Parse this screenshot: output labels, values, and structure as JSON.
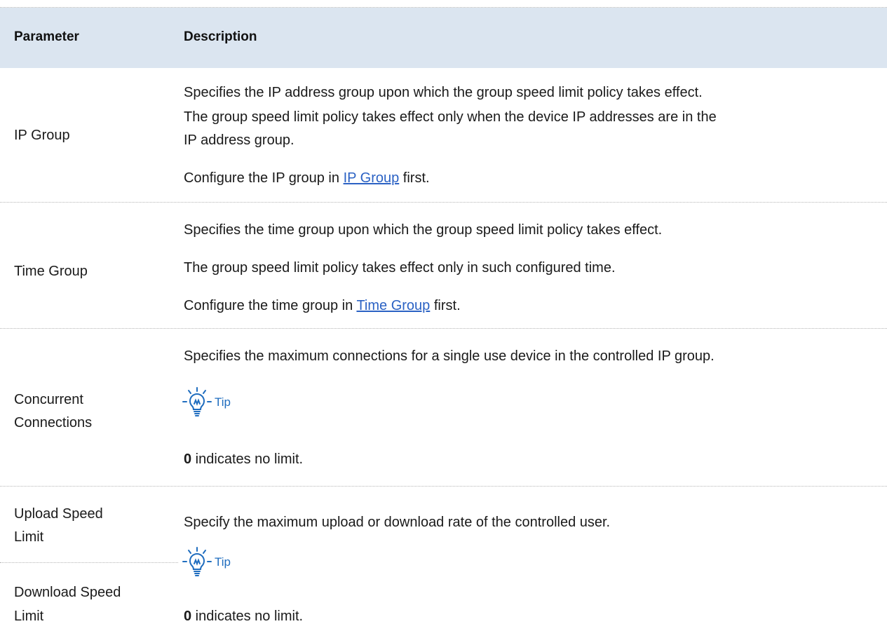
{
  "table": {
    "headers": [
      "Parameter",
      "Description"
    ],
    "rows": [
      {
        "param": "IP Group",
        "lines": [
          "Specifies the IP address group upon which the group speed limit policy takes effect.",
          "The group speed limit policy takes effect only when the device IP addresses are in the",
          "IP address group."
        ],
        "config_prefix": "Configure the IP group in ",
        "config_link": "IP Group",
        "config_suffix": " first."
      },
      {
        "param": "Time Group",
        "line1": "Specifies the time group upon which the group speed limit policy takes effect.",
        "line2": "The group speed limit policy takes effect only in such configured time.",
        "config_prefix": "Configure the time group in ",
        "config_link": "Time Group",
        "config_suffix": " first."
      },
      {
        "param_line1": "Concurrent",
        "param_line2": "Connections",
        "line1": "Specifies the maximum connections for a single use device in the controlled IP group.",
        "tip_label": "Tip",
        "note_bold": "0",
        "note_rest": " indicates no limit."
      },
      {
        "param_a_line1": "Upload Speed",
        "param_a_line2": "Limit",
        "param_b_line1": "Download Speed",
        "param_b_line2": "Limit",
        "line1": "Specify the maximum upload or download rate of the controlled user.",
        "tip_label": "Tip",
        "note_bold": "0",
        "note_rest": " indicates no limit."
      }
    ]
  },
  "colors": {
    "header_bg": "#dbe5f0",
    "link": "#2b62c4",
    "tip": "#1f6dbf"
  }
}
